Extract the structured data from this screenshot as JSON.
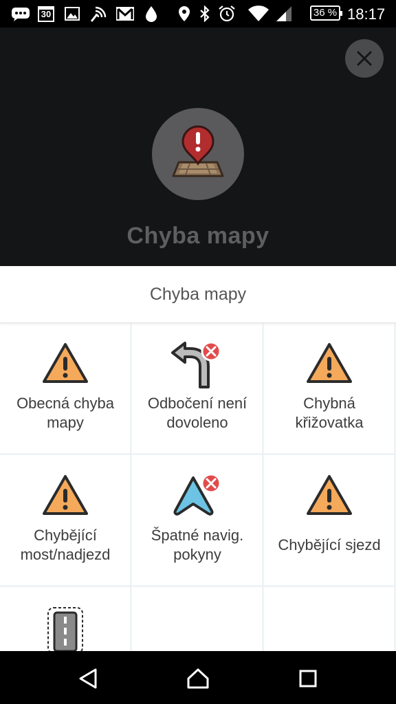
{
  "status_bar": {
    "time": "18:17",
    "battery": "36 %",
    "calendar_day": "30",
    "icons": [
      "chat-icon",
      "calendar-icon",
      "image-icon",
      "wireless-icon",
      "gmail-icon",
      "drop-icon",
      "location-icon",
      "bluetooth-icon",
      "alarm-icon",
      "wifi-icon",
      "signal-icon"
    ]
  },
  "header": {
    "title": "Chyba mapy",
    "hero_icon": "map-error-icon",
    "close_icon": "close-icon"
  },
  "sheet": {
    "title": "Chyba mapy",
    "items": [
      {
        "label": "Obecná chyba mapy",
        "icon": "warning-icon"
      },
      {
        "label": "Odbočení není dovoleno",
        "icon": "no-turn-icon"
      },
      {
        "label": "Chybná křižovatka",
        "icon": "warning-icon"
      },
      {
        "label": "Chybějící most/nadjezd",
        "icon": "warning-icon"
      },
      {
        "label": "Špatné navig. pokyny",
        "icon": "wrong-navigation-icon"
      },
      {
        "label": "Chybějící sjezd",
        "icon": "warning-icon"
      },
      {
        "label": "",
        "icon": "road-icon"
      }
    ]
  },
  "nav_bar": {
    "icons": [
      "back-icon",
      "home-icon",
      "recents-icon"
    ]
  },
  "colors": {
    "accent_orange": "#F5A95B",
    "warning_red": "#E24B4B",
    "arrow_blue": "#6CC3E3",
    "header_bg": "#141517"
  }
}
